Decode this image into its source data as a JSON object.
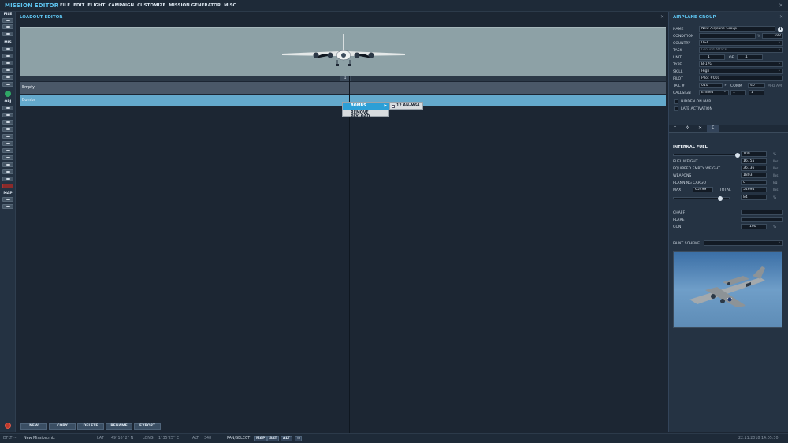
{
  "app": {
    "title": "MISSION EDITOR",
    "menu": [
      "FILE",
      "EDIT",
      "FLIGHT",
      "CAMPAIGN",
      "CUSTOMIZE",
      "MISSION GENERATOR",
      "MISC"
    ]
  },
  "left_toolbar": {
    "file_label": "FILE",
    "mis_label": "MIS",
    "obj_label": "OBJ",
    "map_label": "MAP"
  },
  "loadout": {
    "title": "LOADOUT EDITOR",
    "column_header": "1",
    "rows": [
      {
        "label": "Empty"
      },
      {
        "label": "Bombs"
      }
    ],
    "context_menu": {
      "bombs": "BOMBS",
      "remove": "REMOVE PAYLOAD",
      "submenu_item": "12 AN-M64"
    },
    "buttons": {
      "new": "NEW",
      "copy": "COPY",
      "delete": "DELETE",
      "rename": "RENAME",
      "export": "EXPORT"
    }
  },
  "airplane_group": {
    "title": "AIRPLANE GROUP",
    "info": "i",
    "fields": {
      "name_label": "NAME",
      "name": "New Airplane Group",
      "condition_label": "CONDITION",
      "condition_unit": "%",
      "condition": "100",
      "country_label": "COUNTRY",
      "country": "USA",
      "task_label": "TASK",
      "task": "Ground Attack",
      "unit_label": "UNIT",
      "unit": "1",
      "of_label": "OF",
      "of": "1",
      "type_label": "TYPE",
      "type": "B-17G",
      "skill_label": "SKILL",
      "skill": "High",
      "pilot_label": "PILOT",
      "pilot": "Pilot #001",
      "tail_label": "TAIL #",
      "tail": "010",
      "comm_label": "COMM",
      "comm": "40",
      "comm_unit": "MHz AM",
      "callsign_label": "CALLSIGN",
      "callsign": "Enfield",
      "callsign_n1": "1",
      "callsign_n2": "1",
      "hidden_on_map": "HIDDEN ON MAP",
      "late_activation": "LATE ACTIVATION"
    },
    "fuel": {
      "section": "INTERNAL FUEL",
      "percent": "100",
      "percent_unit": "%",
      "fuel_weight_label": "FUEL WEIGHT",
      "fuel_weight": "16755",
      "equipped_empty_label": "EQUIPPED EMPTY WEIGHT",
      "equipped_empty": "36136",
      "weapons_label": "WEAPONS",
      "weapons": "1803",
      "cargo_label": "PLANNING CARGO",
      "cargo": "0",
      "max_label": "MAX",
      "max": "65499",
      "total_label": "TOTAL",
      "total": "54694",
      "load_percent": "84",
      "unit_lbs": "lbs",
      "unit_kg": "kg",
      "chaff_label": "CHAFF",
      "flare_label": "FLARE",
      "gun_label": "GUN",
      "gun": "100",
      "gun_unit": "%",
      "fuel_fraction": 1.0,
      "load_fraction": 0.84
    },
    "paint_scheme_label": "PAINT SCHEME"
  },
  "status_bar": {
    "dflt": "DFLT ~",
    "mission": "New Mission.miz",
    "lat_label": "LAT",
    "lat": "49°16' 2'' N",
    "long_label": "LONG",
    "long": "1°35'25'' E",
    "alt_label": "ALT",
    "alt": "348",
    "pan_select": "PAN/SELECT",
    "map": "MAP",
    "sat": "SAT",
    "alt_btn": "ALT",
    "datetime": "22.11.2018 14:05:30"
  }
}
